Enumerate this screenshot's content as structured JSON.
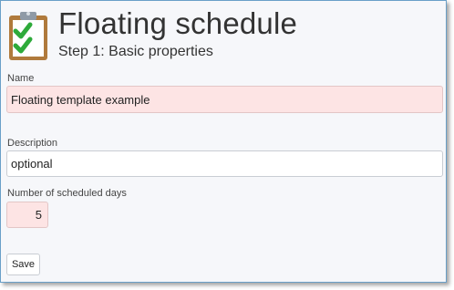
{
  "header": {
    "title": "Floating schedule",
    "subtitle": "Step 1: Basic properties",
    "icon": "clipboard-checklist-icon"
  },
  "form": {
    "name": {
      "label": "Name",
      "value": "Floating template example",
      "state": "invalid"
    },
    "description": {
      "label": "Description",
      "value": "optional"
    },
    "scheduled_days": {
      "label": "Number of scheduled days",
      "value": "5",
      "state": "invalid"
    },
    "save_label": "Save"
  },
  "colors": {
    "invalid_field_bg": "#fde4e4",
    "frame_border": "#6aa0c8",
    "check_green": "#2eaa3a",
    "clipboard_brown": "#b07a3c"
  }
}
